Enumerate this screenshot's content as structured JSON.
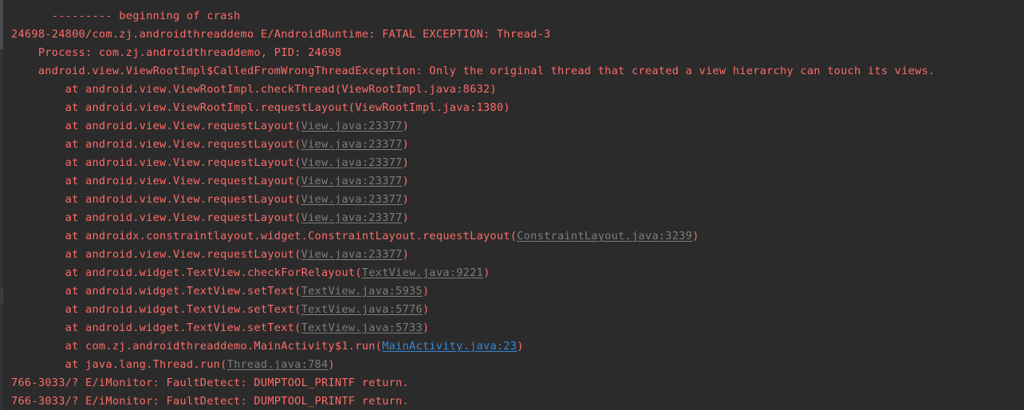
{
  "console": {
    "theme": "darcula",
    "background_color": "#2b2b2b",
    "text_color": "#ff6b68",
    "external_link_color": "#7d7d7d",
    "project_link_color": "#3b87d4",
    "scrollbar": {
      "track_color": "#313335",
      "thumb_color": "#4a4d4f"
    }
  },
  "lines": [
    {
      "name": "log-line-beginning-of-crash",
      "segments": [
        {
          "kind": "text",
          "value": "      --------- beginning of crash"
        }
      ]
    },
    {
      "name": "log-line-fatal-exception",
      "segments": [
        {
          "kind": "text",
          "value": "24698-24800/com.zj.androidthreaddemo E/AndroidRuntime: FATAL EXCEPTION: Thread-3"
        }
      ]
    },
    {
      "name": "log-line-process-pid",
      "segments": [
        {
          "kind": "text",
          "value": "    Process: com.zj.androidthreaddemo, PID: 24698"
        }
      ]
    },
    {
      "name": "log-line-exception-message",
      "segments": [
        {
          "kind": "text",
          "value": "    android.view.ViewRootImpl$CalledFromWrongThreadException: Only the original thread that created a view hierarchy can touch its views."
        }
      ]
    },
    {
      "name": "log-line-stack-checkthread",
      "segments": [
        {
          "kind": "text",
          "value": "        at android.view.ViewRootImpl.checkThread(ViewRootImpl.java:8632)"
        }
      ]
    },
    {
      "name": "log-line-stack-viewrootimpl-requestlayout",
      "segments": [
        {
          "kind": "text",
          "value": "        at android.view.ViewRootImpl.requestLayout(ViewRootImpl.java:1380)"
        }
      ]
    },
    {
      "name": "log-line-stack-view-requestlayout-1",
      "segments": [
        {
          "kind": "text",
          "value": "        at android.view.View.requestLayout("
        },
        {
          "kind": "link-ext",
          "value": "View.java:23377"
        },
        {
          "kind": "text",
          "value": ")"
        }
      ]
    },
    {
      "name": "log-line-stack-view-requestlayout-2",
      "segments": [
        {
          "kind": "text",
          "value": "        at android.view.View.requestLayout("
        },
        {
          "kind": "link-ext",
          "value": "View.java:23377"
        },
        {
          "kind": "text",
          "value": ")"
        }
      ]
    },
    {
      "name": "log-line-stack-view-requestlayout-3",
      "segments": [
        {
          "kind": "text",
          "value": "        at android.view.View.requestLayout("
        },
        {
          "kind": "link-ext",
          "value": "View.java:23377"
        },
        {
          "kind": "text",
          "value": ")"
        }
      ]
    },
    {
      "name": "log-line-stack-view-requestlayout-4",
      "segments": [
        {
          "kind": "text",
          "value": "        at android.view.View.requestLayout("
        },
        {
          "kind": "link-ext",
          "value": "View.java:23377"
        },
        {
          "kind": "text",
          "value": ")"
        }
      ]
    },
    {
      "name": "log-line-stack-view-requestlayout-5",
      "segments": [
        {
          "kind": "text",
          "value": "        at android.view.View.requestLayout("
        },
        {
          "kind": "link-ext",
          "value": "View.java:23377"
        },
        {
          "kind": "text",
          "value": ")"
        }
      ]
    },
    {
      "name": "log-line-stack-view-requestlayout-6",
      "segments": [
        {
          "kind": "text",
          "value": "        at android.view.View.requestLayout("
        },
        {
          "kind": "link-ext",
          "value": "View.java:23377"
        },
        {
          "kind": "text",
          "value": ")"
        }
      ]
    },
    {
      "name": "log-line-stack-constraintlayout-requestlayout",
      "segments": [
        {
          "kind": "text",
          "value": "        at androidx.constraintlayout.widget.ConstraintLayout.requestLayout("
        },
        {
          "kind": "link-ext",
          "value": "ConstraintLayout.java:3239"
        },
        {
          "kind": "text",
          "value": ")"
        }
      ]
    },
    {
      "name": "log-line-stack-view-requestlayout-7",
      "segments": [
        {
          "kind": "text",
          "value": "        at android.view.View.requestLayout("
        },
        {
          "kind": "link-ext",
          "value": "View.java:23377"
        },
        {
          "kind": "text",
          "value": ")"
        }
      ]
    },
    {
      "name": "log-line-stack-checkforrelayout",
      "segments": [
        {
          "kind": "text",
          "value": "        at android.widget.TextView.checkForRelayout("
        },
        {
          "kind": "link-ext",
          "value": "TextView.java:9221"
        },
        {
          "kind": "text",
          "value": ")"
        }
      ]
    },
    {
      "name": "log-line-stack-settext-1",
      "segments": [
        {
          "kind": "text",
          "value": "        at android.widget.TextView.setText("
        },
        {
          "kind": "link-ext",
          "value": "TextView.java:5935"
        },
        {
          "kind": "text",
          "value": ")"
        }
      ]
    },
    {
      "name": "log-line-stack-settext-2",
      "segments": [
        {
          "kind": "text",
          "value": "        at android.widget.TextView.setText("
        },
        {
          "kind": "link-ext",
          "value": "TextView.java:5776"
        },
        {
          "kind": "text",
          "value": ")"
        }
      ]
    },
    {
      "name": "log-line-stack-settext-3",
      "segments": [
        {
          "kind": "text",
          "value": "        at android.widget.TextView.setText("
        },
        {
          "kind": "link-ext",
          "value": "TextView.java:5733"
        },
        {
          "kind": "text",
          "value": ")"
        }
      ]
    },
    {
      "name": "log-line-stack-mainactivity-run",
      "segments": [
        {
          "kind": "text",
          "value": "        at com.zj.androidthreaddemo.MainActivity$1.run("
        },
        {
          "kind": "link-prj",
          "value": "MainActivity.java:23"
        },
        {
          "kind": "text",
          "value": ")"
        }
      ]
    },
    {
      "name": "log-line-stack-thread-run",
      "segments": [
        {
          "kind": "text",
          "value": "        at java.lang.Thread.run("
        },
        {
          "kind": "link-ext",
          "value": "Thread.java:784"
        },
        {
          "kind": "text",
          "value": ")"
        }
      ]
    },
    {
      "name": "log-line-imonitor-1",
      "segments": [
        {
          "kind": "text",
          "value": "766-3033/? E/iMonitor: FaultDetect: DUMPTOOL_PRINTF return."
        }
      ]
    },
    {
      "name": "log-line-imonitor-2",
      "segments": [
        {
          "kind": "text",
          "value": "766-3033/? E/iMonitor: FaultDetect: DUMPTOOL_PRINTF return."
        }
      ]
    }
  ]
}
